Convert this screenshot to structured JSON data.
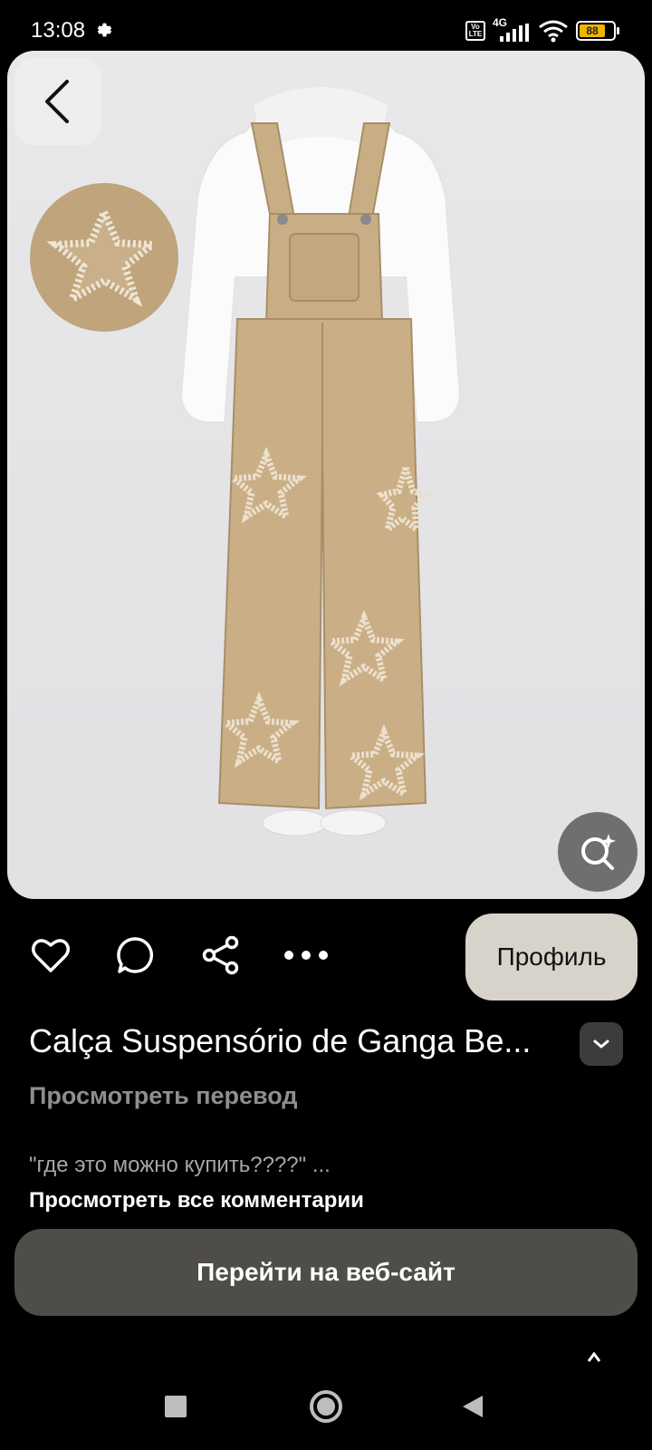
{
  "status_bar": {
    "time": "13:08",
    "volte_label": "Vo LTE",
    "network_label": "4G",
    "battery_level": "88"
  },
  "product": {
    "title": "Calça Suspensório de Ganga Be...",
    "translate_label": "Просмотреть перевод",
    "profile_label": "Профиль"
  },
  "comments": {
    "preview": "\"где это можно купить????\" ...",
    "all_label": "Просмотреть все комментарии"
  },
  "cta": {
    "website_label": "Перейти на веб-сайт"
  },
  "icons": {
    "back": "back-arrow-icon",
    "lens": "visual-search-icon",
    "like": "heart-icon",
    "comment": "comment-bubble-icon",
    "share": "share-icon",
    "more": "more-dots-icon",
    "expand": "chevron-down-icon"
  },
  "colors": {
    "background": "#000000",
    "profile_button": "#d7d3cb",
    "website_button": "#4f4d48",
    "denim": "#c9ad84"
  }
}
